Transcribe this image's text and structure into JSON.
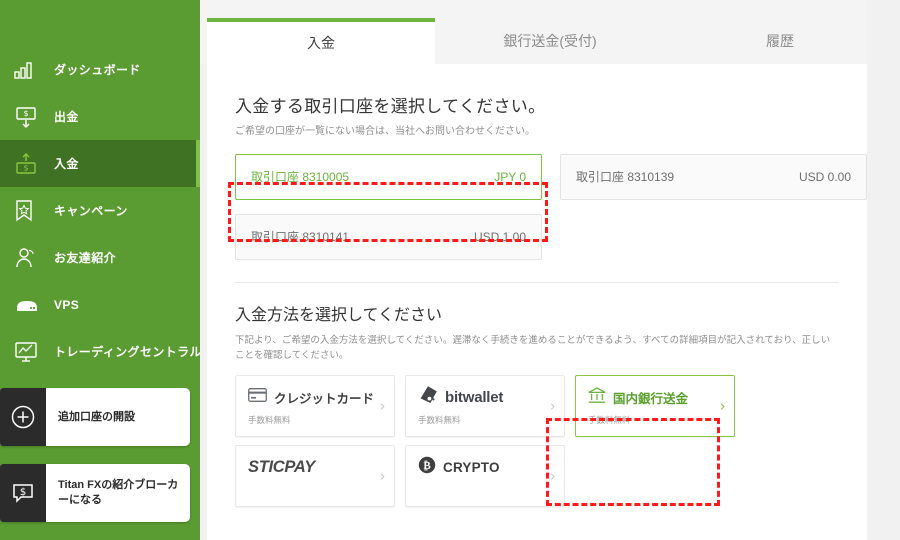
{
  "sidebar": {
    "items": [
      {
        "label": "ダッシュボード",
        "icon": "bar-chart-icon",
        "key": "dashboard",
        "active": false
      },
      {
        "label": "出金",
        "icon": "withdraw-icon",
        "key": "withdraw",
        "active": false
      },
      {
        "label": "入金",
        "icon": "deposit-icon",
        "key": "deposit",
        "active": true
      },
      {
        "label": "キャンペーン",
        "icon": "bookmark-star-icon",
        "key": "campaign",
        "active": false
      },
      {
        "label": "お友達紹介",
        "icon": "person-icon",
        "key": "referral",
        "active": false
      },
      {
        "label": "VPS",
        "icon": "server-icon",
        "key": "vps",
        "active": false
      },
      {
        "label": "トレーディングセントラル",
        "icon": "monitor-chart-icon",
        "key": "trading-central",
        "active": false
      }
    ],
    "cta": [
      {
        "label": "追加口座の開設",
        "icon": "plus-circle-icon",
        "key": "open-additional-account"
      },
      {
        "label": "Titan FXの紹介ブローカーになる",
        "icon": "dollar-speech-icon",
        "key": "become-ib"
      }
    ]
  },
  "tabs": [
    {
      "label": "入金",
      "key": "deposit",
      "active": true
    },
    {
      "label": "銀行送金(受付)",
      "key": "bank-transfer-reception",
      "active": false
    },
    {
      "label": "履歴",
      "key": "history",
      "active": false
    }
  ],
  "account_section": {
    "title": "入金する取引口座を選択してください。",
    "subtitle": "ご希望の口座が一覧にない場合は、当社へお問い合わせください。",
    "accounts": [
      {
        "name": "取引口座 8310005",
        "balance": "JPY 0",
        "selected": true
      },
      {
        "name": "取引口座 8310139",
        "balance": "USD 0.00",
        "selected": false
      },
      {
        "name": "取引口座 8310141",
        "balance": "USD 1.00",
        "selected": false
      }
    ]
  },
  "method_section": {
    "title": "入金方法を選択してください",
    "description": "下記より、ご希望の入金方法を選択してください。遅滞なく手続きを進めることができるよう、すべての詳細項目が記入されており、正しいことを確認してください。",
    "methods": [
      {
        "name": "クレジットカード",
        "fee": "手数料無料",
        "icon": "credit-card-icon",
        "selected": false,
        "logo_style": "text"
      },
      {
        "name": "bitwallet",
        "fee": "手数料無料",
        "icon": "bitwallet-icon",
        "selected": false,
        "logo_style": "bitwallet"
      },
      {
        "name": "国内銀行送金",
        "fee": "手数料無料",
        "icon": "bank-icon",
        "selected": true,
        "logo_style": "text"
      },
      {
        "name": "STICPAY",
        "fee": "",
        "icon": "sticpay-icon",
        "selected": false,
        "logo_style": "sticpay"
      },
      {
        "name": "CRYPTO",
        "fee": "",
        "icon": "bitcoin-icon",
        "selected": false,
        "logo_style": "crypto"
      }
    ]
  },
  "colors": {
    "sidebar_green": "#5a9c31",
    "sidebar_active_green": "#3f7223",
    "accent_green": "#6cb33f",
    "indicator_green": "#7dc242",
    "annotation_red": "#ff1a1a",
    "muted_text": "#8f8f8f"
  }
}
